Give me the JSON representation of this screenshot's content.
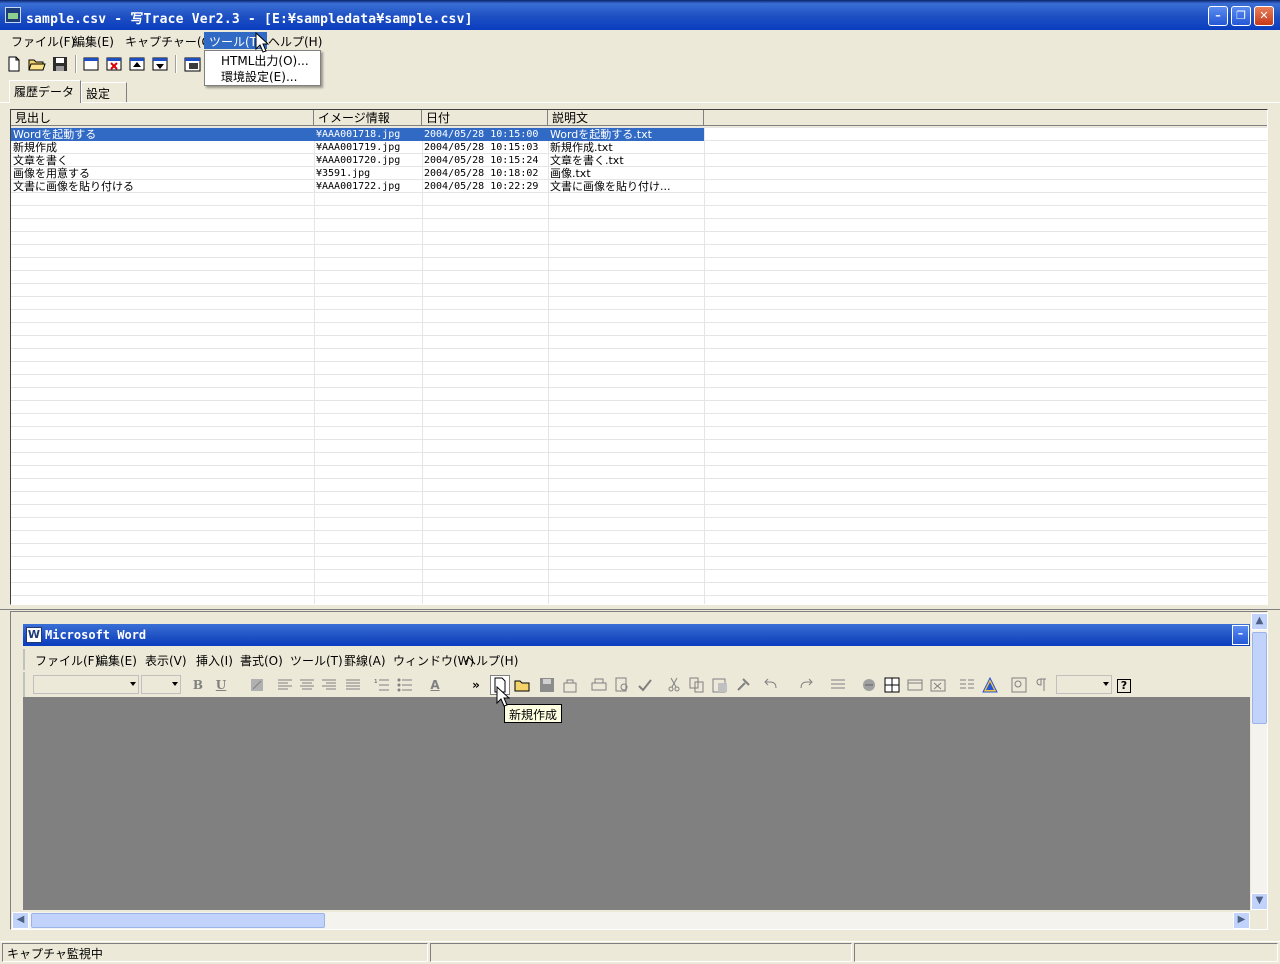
{
  "window": {
    "title": "sample.csv - 写Trace Ver2.3 - [E:¥sampledata¥sample.csv]",
    "minimize_label": "–",
    "restore_label": "❐",
    "close_label": "✕"
  },
  "menubar": {
    "items": [
      "ファイル(F)",
      "編集(E)",
      "キャプチャー(C)",
      "ツール(T)",
      "ヘルプ(H)"
    ],
    "active_index": 3
  },
  "tools_menu": {
    "items": [
      "HTML出力(O)...",
      "環境設定(E)..."
    ]
  },
  "tabs": [
    "履歴データ",
    "設定"
  ],
  "selected_tab": 0,
  "list": {
    "columns": [
      "見出し",
      "イメージ情報",
      "日付",
      "説明文"
    ],
    "rows": [
      {
        "heading": "Wordを起動する",
        "image": "¥AAA001718.jpg",
        "date": "2004/05/28 10:15:00",
        "description": "Wordを起動する.txt",
        "selected": true
      },
      {
        "heading": "新規作成",
        "image": "¥AAA001719.jpg",
        "date": "2004/05/28 10:15:03",
        "description": "新規作成.txt",
        "selected": false
      },
      {
        "heading": "文章を書く",
        "image": "¥AAA001720.jpg",
        "date": "2004/05/28 10:15:24",
        "description": "文章を書く.txt",
        "selected": false
      },
      {
        "heading": "画像を用意する",
        "image": "¥3591.jpg",
        "date": "2004/05/28 10:18:02",
        "description": "画像.txt",
        "selected": false
      },
      {
        "heading": "文書に画像を貼り付ける",
        "image": "¥AAA001722.jpg",
        "date": "2004/05/28 10:22:29",
        "description": "文書に画像を貼り付け...",
        "selected": false
      }
    ]
  },
  "word": {
    "title": "Microsoft Word",
    "icon_letter": "W",
    "minimize_label": "–",
    "menu": [
      "ファイル(F)",
      "編集(E)",
      "表示(V)",
      "挿入(I)",
      "書式(O)",
      "ツール(T)",
      "罫線(A)",
      "ウィンドウ(W)",
      "ヘルプ(H)"
    ],
    "format_buttons": {
      "bold": "B",
      "underline": "U",
      "font_color": "A",
      "more": "»",
      "help": "?"
    },
    "tooltip": "新規作成"
  },
  "statusbar": {
    "text": "キャプチャ監視中"
  },
  "colors": {
    "selection": "#316ac5",
    "titlebar": "#1d4fc2",
    "face": "#ece9d8",
    "doc_background": "#808080",
    "tooltip": "#ffffe1"
  },
  "icons": {
    "toolbar": [
      "new-file-icon",
      "open-folder-icon",
      "save-disk-icon",
      "window-view-icon",
      "delete-record-icon",
      "move-up-icon",
      "move-down-icon",
      "capture-icon"
    ]
  }
}
